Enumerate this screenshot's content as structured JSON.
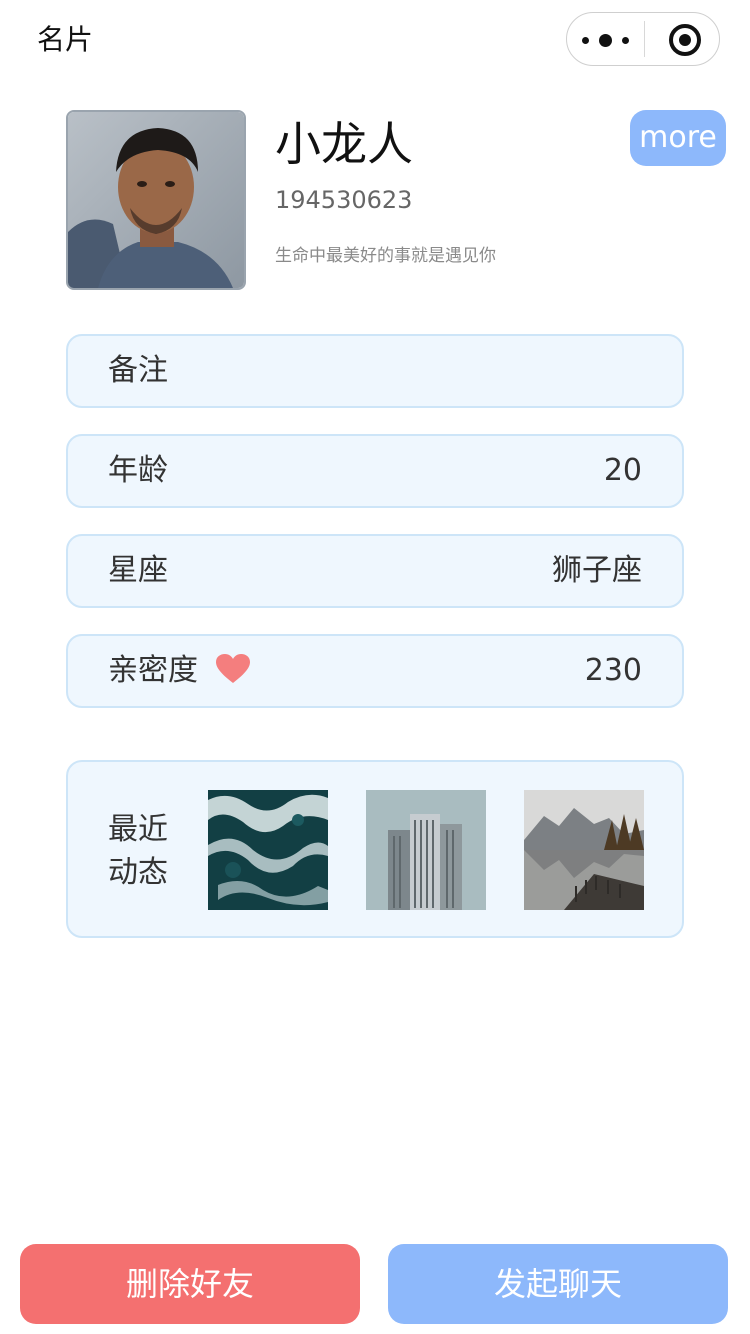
{
  "nav": {
    "title": "名片"
  },
  "profile": {
    "nickname": "小龙人",
    "id": "194530623",
    "signature": "生命中最美好的事就是遇见你",
    "more_label": "more"
  },
  "info": {
    "remark_label": "备注",
    "remark_value": "",
    "age_label": "年龄",
    "age_value": "20",
    "zodiac_label": "星座",
    "zodiac_value": "狮子座",
    "intimacy_label": "亲密度",
    "intimacy_icon": "heart-icon",
    "intimacy_value": "230"
  },
  "moments": {
    "label_line1": "最近",
    "label_line2": "动态"
  },
  "actions": {
    "delete_label": "删除好友",
    "chat_label": "发起聊天"
  },
  "colors": {
    "delete": "#f47070",
    "chat": "#8db8fb",
    "row_bg": "#eff7fe",
    "row_border": "#cde5f8",
    "heart": "#f47e7e"
  }
}
